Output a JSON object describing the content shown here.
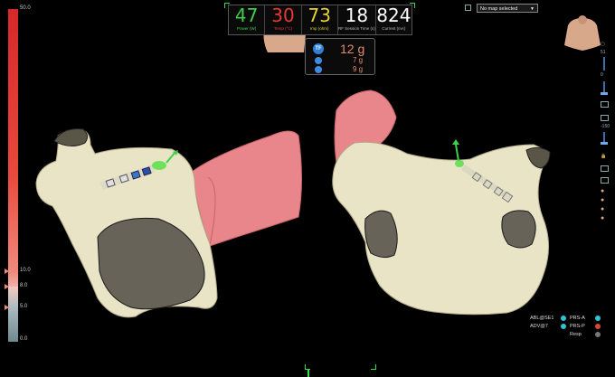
{
  "scale": {
    "top_label": "50.0",
    "labels": [
      "10.0",
      "8.0",
      "5.0",
      "0.0"
    ]
  },
  "metrics": [
    {
      "value": "47",
      "label": "Power (W)",
      "color": "#3fd04a"
    },
    {
      "value": "30",
      "label": "Temp (°C)",
      "color": "#e83a30"
    },
    {
      "value": "73",
      "label": "Imp (ohm)",
      "color": "#e6d234"
    },
    {
      "value": "18",
      "label": "RF Session Time (s)",
      "color": "#ffffff"
    },
    {
      "value": "824",
      "label": "Current (mA)",
      "color": "#ffffff"
    }
  ],
  "force": {
    "badge": "TF",
    "main": "12 g",
    "sub1": "7 g",
    "sub2": "9 g"
  },
  "map_select": {
    "value": "No map selected"
  },
  "toolbar": {
    "value_top": "51",
    "value_mid1": "0",
    "value_mid2": "-150"
  },
  "legend": {
    "left": [
      "ABL@SE1",
      "ADV@7"
    ],
    "right": [
      "PRS-A",
      "PRS-P",
      "Resp"
    ],
    "colors": [
      "#2ec4d6",
      "#2ec4d6",
      "#2ec4d6",
      "#e0452f",
      "#777777"
    ]
  }
}
